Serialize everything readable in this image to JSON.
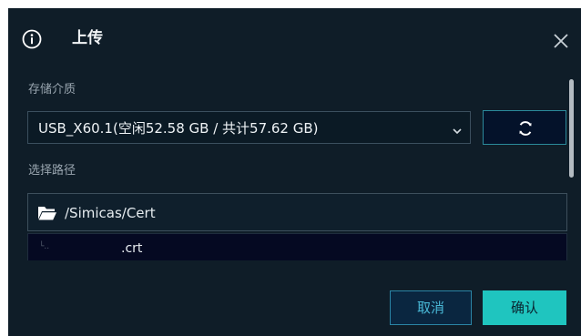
{
  "dialog": {
    "title": "上传",
    "icons": {
      "info": "info-circle-icon",
      "close": "close-icon",
      "dropdown": "chevron-down-icon",
      "refresh": "refresh-icon",
      "folder": "folder-open-icon"
    },
    "colors": {
      "background": "#0f1d28",
      "accent": "#1fc5bf",
      "link_text": "#49b8d6"
    }
  },
  "storage": {
    "label": "存储介质",
    "selected": "USB_X60.1(空闲52.58 GB / 共计57.62 GB)"
  },
  "path": {
    "label": "选择路径",
    "current": "/Simicas/Cert"
  },
  "files": [
    {
      "tree_prefix": "└..",
      "name": ".crt"
    }
  ],
  "buttons": {
    "cancel": "取消",
    "confirm": "确认"
  }
}
